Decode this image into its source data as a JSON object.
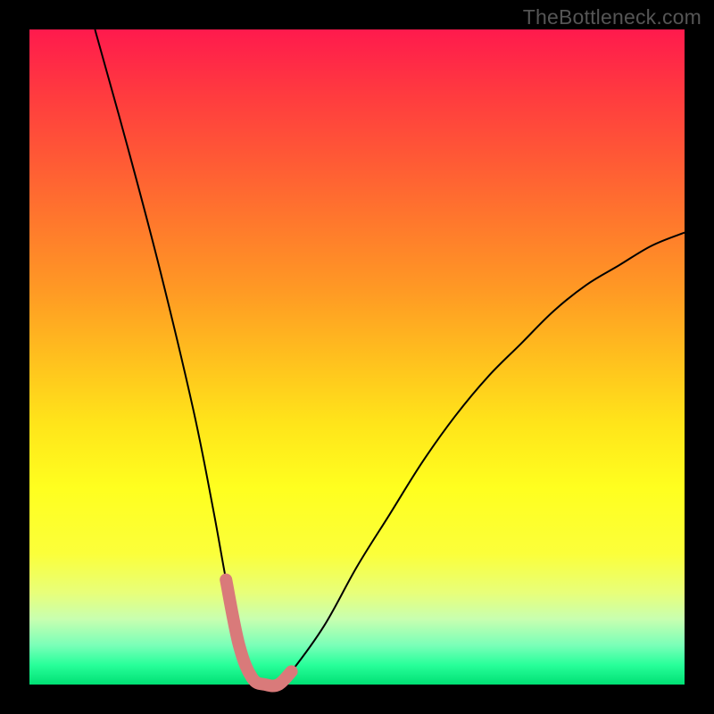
{
  "watermark": "TheBottleneck.com",
  "chart_data": {
    "type": "line",
    "title": "",
    "xlabel": "",
    "ylabel": "",
    "xlim": [
      0,
      100
    ],
    "ylim": [
      0,
      100
    ],
    "series": [
      {
        "name": "bottleneck-curve",
        "x": [
          10,
          15,
          20,
          25,
          28,
          30,
          32,
          34,
          36,
          38,
          40,
          45,
          50,
          55,
          60,
          65,
          70,
          75,
          80,
          85,
          90,
          95,
          100
        ],
        "values": [
          100,
          82,
          63,
          42,
          27,
          16,
          6,
          1,
          0,
          0,
          2,
          9,
          18,
          26,
          34,
          41,
          47,
          52,
          57,
          61,
          64,
          67,
          69
        ]
      }
    ],
    "highlight": {
      "name": "highlighted-range",
      "x": [
        30,
        32,
        34,
        36,
        38,
        40
      ],
      "values": [
        16,
        6,
        1,
        0,
        0,
        2
      ],
      "color": "#d97a7a"
    },
    "colors": {
      "curve": "#000000",
      "highlight": "#d97a7a",
      "gradient_top": "#ff1a4d",
      "gradient_bottom": "#00e074"
    }
  }
}
